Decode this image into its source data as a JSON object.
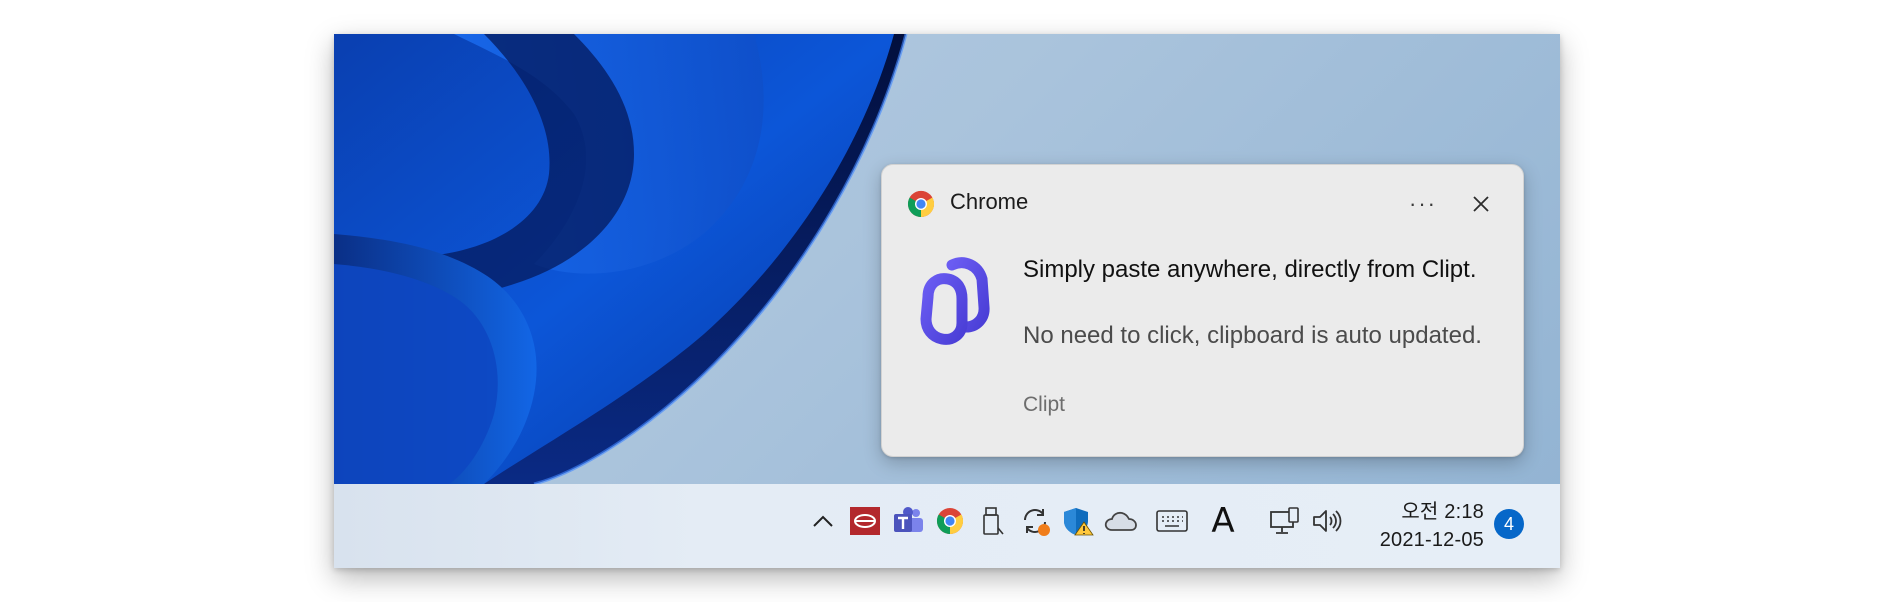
{
  "notification": {
    "app_name": "Chrome",
    "more_icon": "more-options-icon",
    "close_icon": "close-icon",
    "app_icon": "chrome-icon",
    "content_icon": "clipt-logo-icon",
    "title": "Simply paste anywhere, directly from Clipt.",
    "body": "No need to click, clipboard is auto updated.",
    "attribution": "Clipt"
  },
  "taskbar": {
    "tray_icons": [
      "show-hidden-icons-chevron-icon",
      "red-app-icon",
      "microsoft-teams-icon",
      "chrome-icon",
      "usb-drive-icon",
      "sync-icon",
      "windows-security-warning-icon",
      "onedrive-cloud-icon",
      "touch-keyboard-icon"
    ],
    "ime_indicator": "A",
    "network_icon": "network-icon",
    "volume_icon": "volume-icon",
    "clock": {
      "time": "오전 2:18",
      "date": "2021-12-05"
    },
    "notification_count": "4"
  },
  "colors": {
    "accent": "#0667c9",
    "clipt_purple": "#5b4fe6",
    "toast_bg": "#ebebeb"
  }
}
